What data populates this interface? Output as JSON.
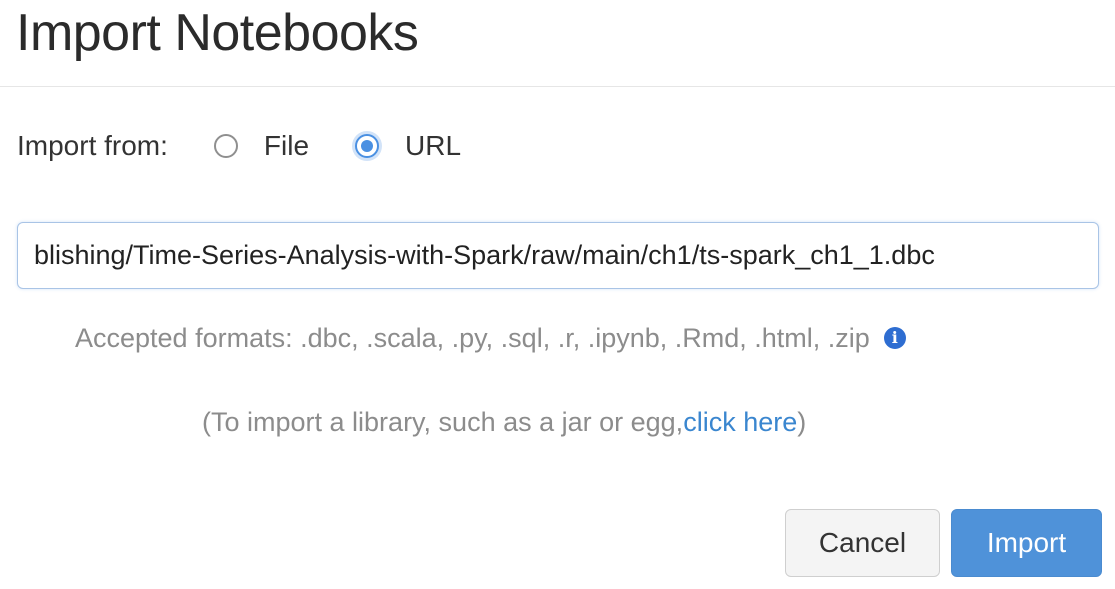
{
  "dialog": {
    "title": "Import Notebooks",
    "import_from": {
      "label": "Import from:",
      "options": [
        {
          "label": "File",
          "checked": false
        },
        {
          "label": "URL",
          "checked": true
        }
      ]
    },
    "url_input": {
      "value": "blishing/Time-Series-Analysis-with-Spark/raw/main/ch1/ts-spark_ch1_1.dbc"
    },
    "accepted_formats": {
      "text": "Accepted formats: .dbc, .scala, .py, .sql, .r, .ipynb, .Rmd, .html, .zip",
      "icon": "info-icon"
    },
    "library_note": {
      "prefix": "(To import a library, such as a jar or egg, ",
      "link": "click here",
      "suffix": ")"
    },
    "buttons": {
      "cancel": "Cancel",
      "import": "Import"
    },
    "colors": {
      "accent": "#4f92d9",
      "link": "#3a86cf",
      "info_icon": "#2e6dd1",
      "muted_text": "#8c8c8c"
    }
  }
}
